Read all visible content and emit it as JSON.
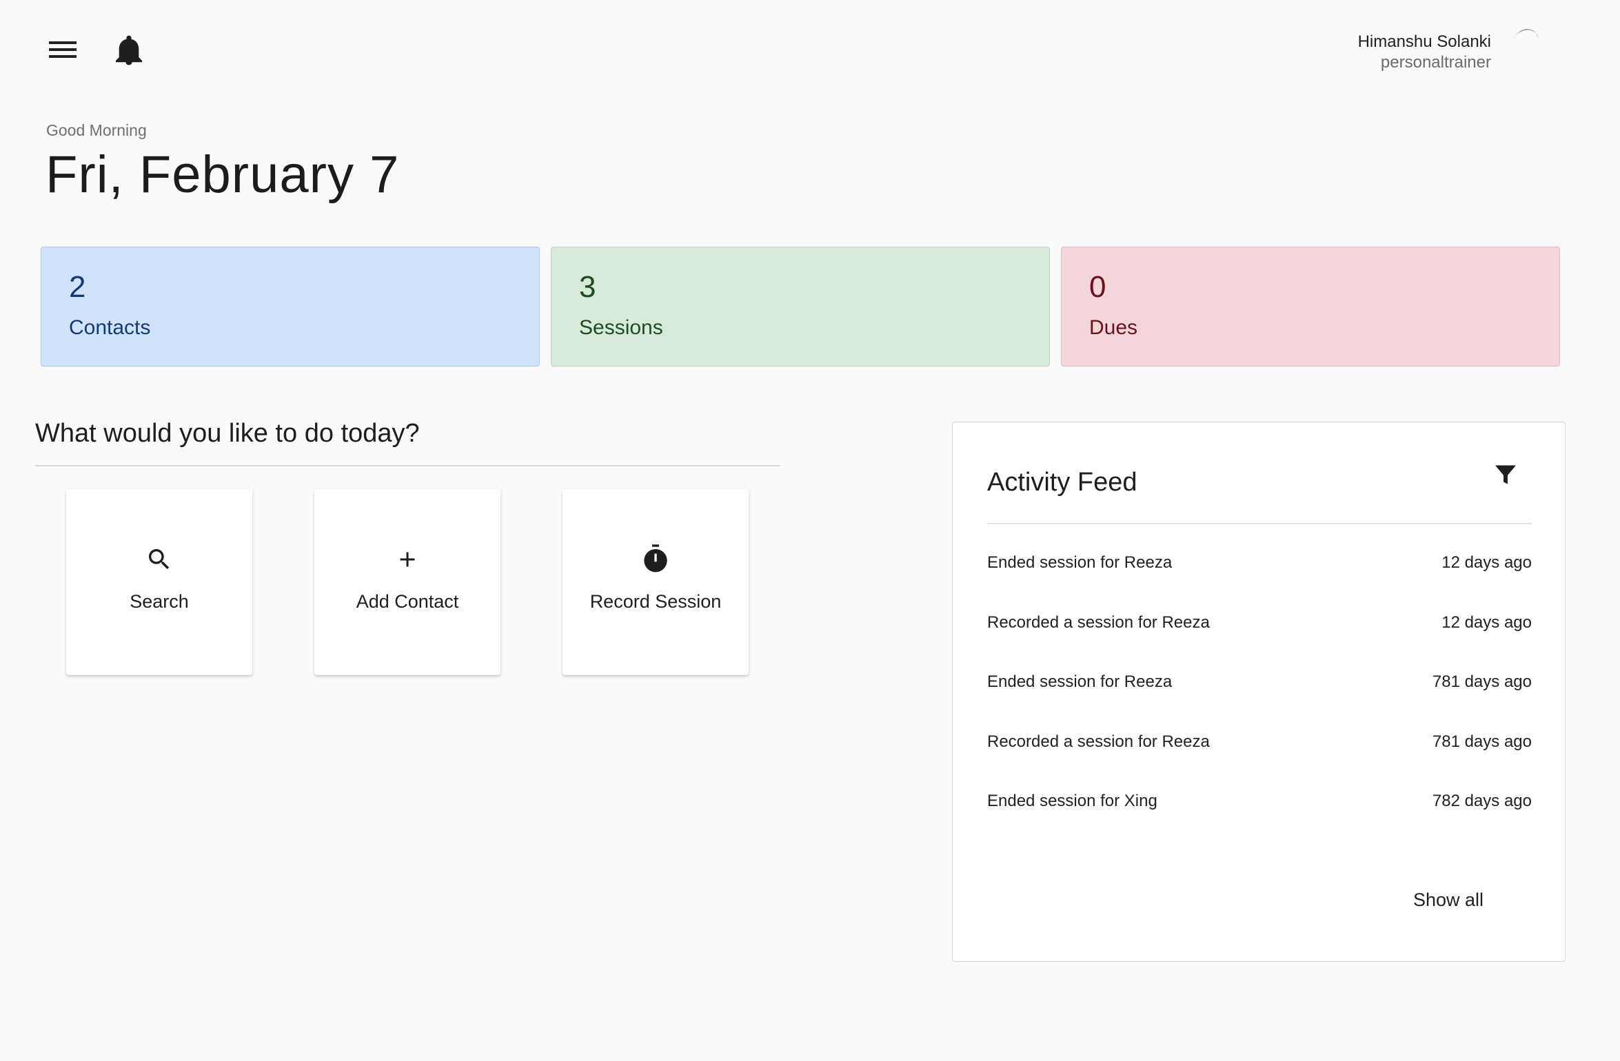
{
  "header": {
    "menu_icon": "hamburger-menu-icon",
    "notification_icon": "bell-icon",
    "user": {
      "name": "Himanshu Solanki",
      "role": "personaltrainer"
    }
  },
  "greeting": {
    "salutation": "Good Morning",
    "date": "Fri, February 7"
  },
  "stats": [
    {
      "value": "2",
      "label": "Contacts",
      "color": "#d1e3fa"
    },
    {
      "value": "3",
      "label": "Sessions",
      "color": "#d8ebdb"
    },
    {
      "value": "0",
      "label": "Dues",
      "color": "#f3d6d9"
    }
  ],
  "actions": {
    "heading": "What would you like to do today?",
    "items": [
      {
        "label": "Search",
        "icon": "search-icon"
      },
      {
        "label": "Add Contact",
        "icon": "plus-icon"
      },
      {
        "label": "Record Session",
        "icon": "stopwatch-icon"
      }
    ]
  },
  "activity_feed": {
    "title": "Activity Feed",
    "filter_icon": "filter-icon",
    "items": [
      {
        "text": "Ended session for Reeza",
        "time": "12 days ago"
      },
      {
        "text": "Recorded a session for Reeza",
        "time": "12 days ago"
      },
      {
        "text": "Ended session for Reeza",
        "time": "781 days ago"
      },
      {
        "text": "Recorded a session for Reeza",
        "time": "781 days ago"
      },
      {
        "text": "Ended session for Xing",
        "time": "782 days ago"
      }
    ],
    "show_all_label": "Show all"
  }
}
